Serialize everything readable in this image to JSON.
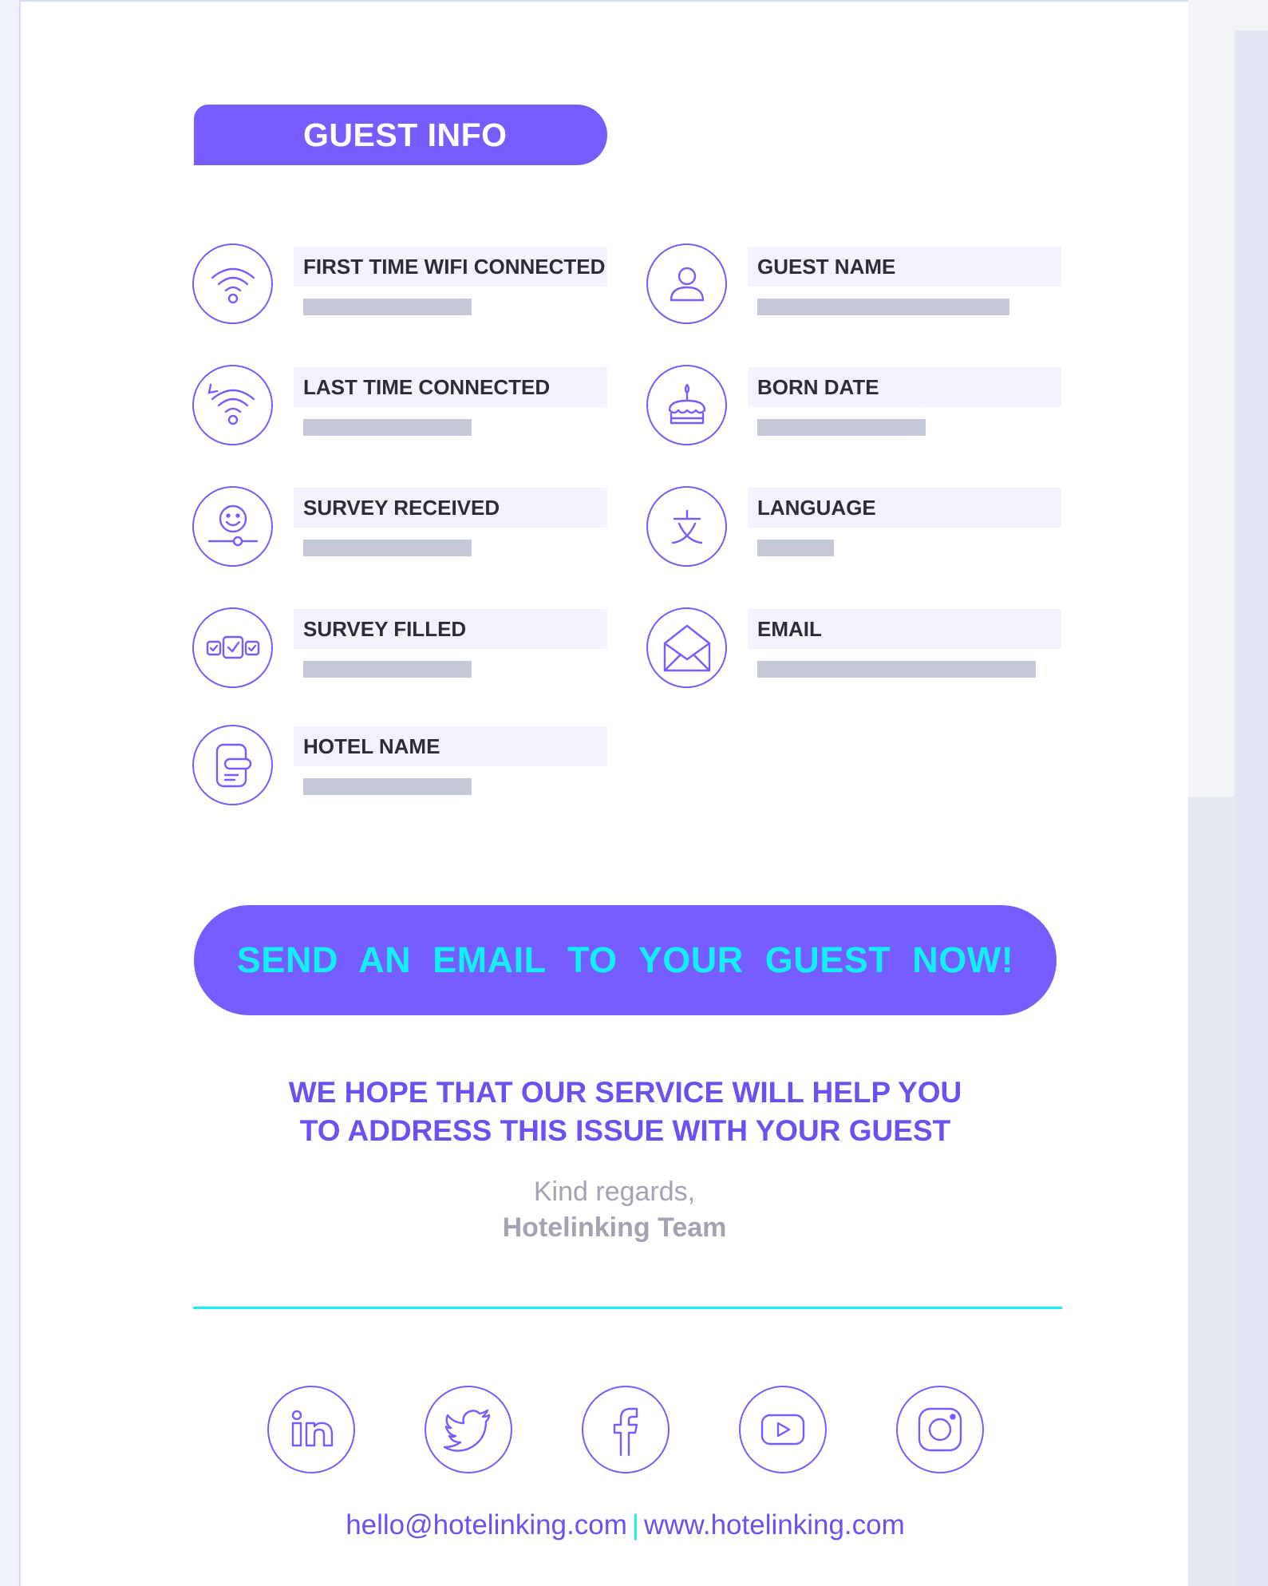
{
  "header": {
    "title": "GUEST INFO"
  },
  "fields": [
    {
      "label": "FIRST TIME WIFI CONNECTED",
      "icon": "wifi-icon"
    },
    {
      "label": "GUEST NAME",
      "icon": "user-icon"
    },
    {
      "label": "LAST TIME CONNECTED",
      "icon": "wifi-history-icon"
    },
    {
      "label": "BORN DATE",
      "icon": "birthday-cake-icon"
    },
    {
      "label": "SURVEY RECEIVED",
      "icon": "smiley-slider-icon"
    },
    {
      "label": "LANGUAGE",
      "icon": "language-icon"
    },
    {
      "label": "SURVEY FILLED",
      "icon": "checkboxes-icon"
    },
    {
      "label": "EMAIL",
      "icon": "envelope-icon"
    },
    {
      "label": "HOTEL NAME",
      "icon": "door-key-card-icon"
    }
  ],
  "cta": {
    "label": "SEND AN EMAIL TO YOUR GUEST NOW!"
  },
  "message": {
    "line1": "WE HOPE THAT OUR SERVICE WILL HELP YOU",
    "line2": "TO ADDRESS THIS ISSUE WITH YOUR GUEST"
  },
  "signature": {
    "regards": "Kind regards,",
    "team": "Hotelinking Team"
  },
  "social": [
    "linkedin-icon",
    "twitter-icon",
    "facebook-icon",
    "youtube-icon",
    "instagram-icon"
  ],
  "footer": {
    "email": "hello@hotelinking.com",
    "separator": "|",
    "website": "www.hotelinking.com"
  },
  "colors": {
    "accent": "#755dff",
    "cyan": "#13f0f4",
    "bar": "#c5c8d6",
    "label_bg": "#f4f3fd"
  }
}
